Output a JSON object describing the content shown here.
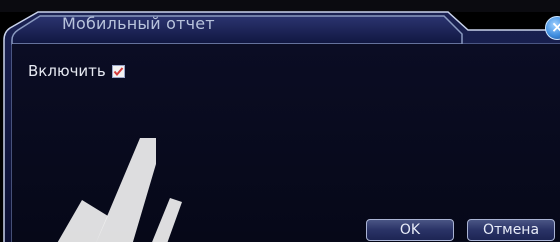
{
  "dialog": {
    "title": "Мобильный отчет",
    "close_glyph": "×",
    "enable_label": "Включить",
    "enable_checked": true,
    "ok_label": "OK",
    "cancel_label": "Отмена"
  },
  "icons": {
    "close": "close-icon",
    "check": "checkmark-icon",
    "watermark": "watermark-logo"
  },
  "colors": {
    "frame_border": "#8a9ac0",
    "title_bar": "#141a46",
    "body": "#080a1e",
    "check_mark": "#d23b3b",
    "watermark": "#f0f0f0"
  }
}
